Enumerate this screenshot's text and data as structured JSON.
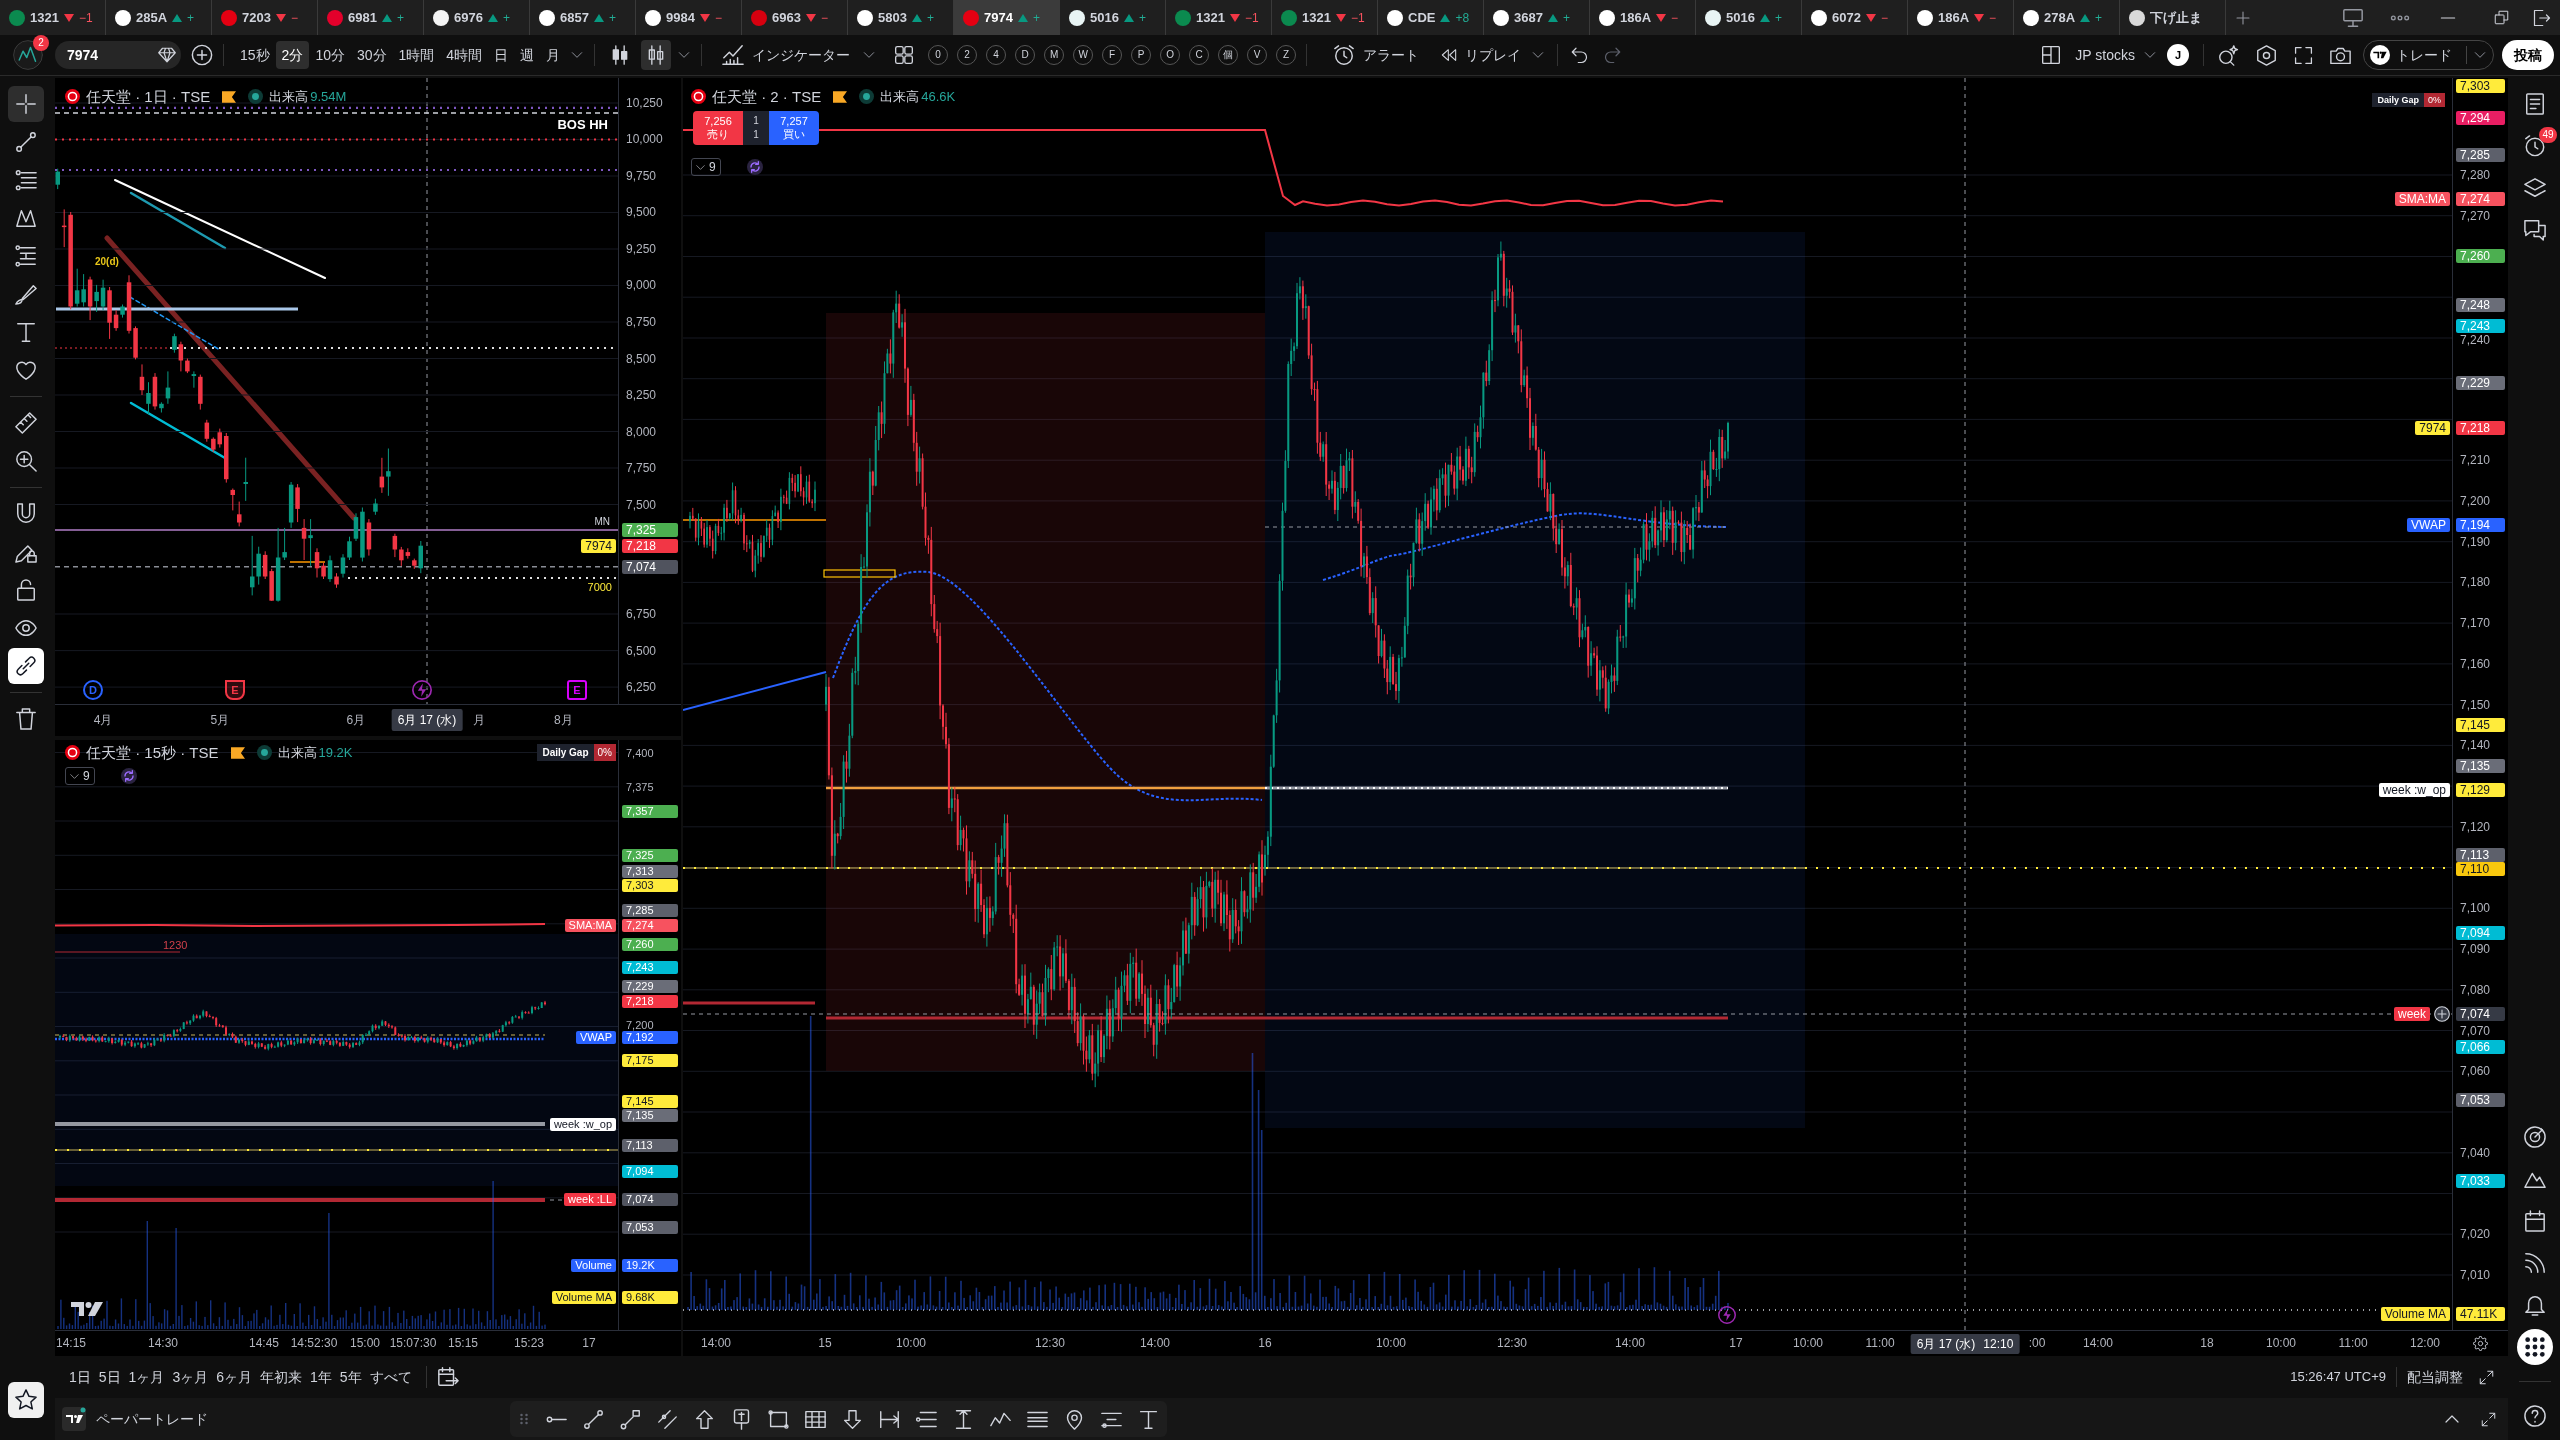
{
  "tabs": [
    {
      "symbol": "1321",
      "change": "−1",
      "rising": false,
      "color": "#0b8a4f",
      "selected": false
    },
    {
      "symbol": "285A",
      "change": "+",
      "rising": true,
      "color": "#ffffff",
      "selected": false
    },
    {
      "symbol": "7203",
      "change": "−",
      "rising": false,
      "color": "#e50012",
      "selected": false
    },
    {
      "symbol": "6981",
      "change": "+",
      "rising": true,
      "color": "#e4002b",
      "selected": false
    },
    {
      "symbol": "6976",
      "change": "+",
      "rising": true,
      "color": "#f4f4f4",
      "selected": false
    },
    {
      "symbol": "6857",
      "change": "+",
      "rising": true,
      "color": "#ffffff",
      "selected": false
    },
    {
      "symbol": "9984",
      "change": "−",
      "rising": false,
      "color": "#ffffff",
      "selected": false
    },
    {
      "symbol": "6963",
      "change": "−",
      "rising": false,
      "color": "#d7000f",
      "selected": false
    },
    {
      "symbol": "5803",
      "change": "+",
      "rising": true,
      "color": "#ffffff",
      "selected": false
    },
    {
      "symbol": "7974",
      "change": "+",
      "rising": true,
      "color": "#e60012",
      "selected": true
    },
    {
      "symbol": "5016",
      "change": "+",
      "rising": true,
      "color": "#e8f4f4",
      "selected": false
    },
    {
      "symbol": "1321",
      "change": "−1",
      "rising": false,
      "color": "#0b8a4f",
      "selected": false
    },
    {
      "symbol": "1321",
      "change": "−1",
      "rising": false,
      "color": "#0b8a4f",
      "selected": false
    },
    {
      "symbol": "CDE",
      "change": "+8",
      "rising": true,
      "color": "#ffffff",
      "selected": false
    },
    {
      "symbol": "3687",
      "change": "+",
      "rising": true,
      "color": "#ffffff",
      "selected": false
    },
    {
      "symbol": "186A",
      "change": "−",
      "rising": false,
      "color": "#ffffff",
      "selected": false
    },
    {
      "symbol": "5016",
      "change": "+",
      "rising": true,
      "color": "#e8f4f4",
      "selected": false
    },
    {
      "symbol": "6072",
      "change": "−",
      "rising": false,
      "color": "#ffffff",
      "selected": false
    },
    {
      "symbol": "186A",
      "change": "−",
      "rising": false,
      "color": "#ffffff",
      "selected": false
    },
    {
      "symbol": "278A",
      "change": "+",
      "rising": true,
      "color": "#ffffff",
      "selected": false
    },
    {
      "symbol": "下げ止ま",
      "color": "#d9d9d9",
      "selected": false
    }
  ],
  "toolbar": {
    "avatar_badge": "2",
    "symbol": "7974",
    "intervals": [
      {
        "label": "15秒",
        "selected": false
      },
      {
        "label": "2分",
        "selected": true
      },
      {
        "label": "10分",
        "selected": false
      },
      {
        "label": "30分",
        "selected": false
      },
      {
        "label": "1時間",
        "selected": false
      },
      {
        "label": "4時間",
        "selected": false
      },
      {
        "label": "日",
        "selected": false
      },
      {
        "label": "週",
        "selected": false
      },
      {
        "label": "月",
        "selected": false
      }
    ],
    "chart_styles": [
      {
        "kind": "candles",
        "selected": false
      },
      {
        "kind": "hollow_candles",
        "selected": true
      }
    ],
    "indicators": "インジケーター",
    "quick_buttons": [
      "0",
      "2",
      "4",
      "D",
      "M",
      "W",
      "F",
      "P",
      "O",
      "C",
      "個",
      "V",
      "Z"
    ],
    "alert": "アラート",
    "replay": "リプレイ",
    "watchlist": "JP stocks",
    "user_initial": "J",
    "trade": "トレード",
    "publish": "投稿"
  },
  "left_toolbar": [
    {
      "kind": "crosshair",
      "active": true
    },
    {
      "kind": "trend_line",
      "active": false
    },
    {
      "kind": "fib",
      "active": false
    },
    {
      "kind": "pattern",
      "active": false
    },
    {
      "kind": "projection",
      "active": false
    },
    {
      "kind": "brush",
      "active": false
    },
    {
      "kind": "text",
      "active": false
    },
    {
      "kind": "favorite",
      "active": false
    },
    {
      "kind": "ruler",
      "active": false
    },
    {
      "kind": "zoom",
      "active": false
    },
    {
      "kind": "magnet",
      "active": false
    },
    {
      "kind": "lock_drawing",
      "active": false
    },
    {
      "kind": "lock",
      "active": false
    },
    {
      "kind": "visibility",
      "active": false
    },
    {
      "kind": "link",
      "active": true
    },
    {
      "kind": "trash",
      "active": false
    }
  ],
  "daily_chart": {
    "title": "任天堂 · 1日 · TSE",
    "volume_label": "出来高",
    "volume": "9.54M",
    "structure_label": "BOS HH",
    "line_label": "20(d)",
    "level_label": "7000",
    "tag_note": "MN",
    "chart_data": {
      "type": "candlestick",
      "grid": true,
      "ylim": [
        6134,
        10421
      ],
      "yticks": [
        {
          "value": 10250,
          "label": "10,250"
        },
        {
          "value": 10000,
          "label": "10,000"
        },
        {
          "value": 9750,
          "label": "9,750"
        },
        {
          "value": 9500,
          "label": "9,500"
        },
        {
          "value": 9250,
          "label": "9,250"
        },
        {
          "value": 9000,
          "label": "9,000"
        },
        {
          "value": 8750,
          "label": "8,750"
        },
        {
          "value": 8500,
          "label": "8,500"
        },
        {
          "value": 8250,
          "label": "8,250"
        },
        {
          "value": 8000,
          "label": "8,000"
        },
        {
          "value": 7750,
          "label": "7,750"
        },
        {
          "value": 7500,
          "label": "7,500"
        },
        {
          "value": 6750,
          "label": "6,750"
        },
        {
          "value": 6500,
          "label": "6,500"
        },
        {
          "value": 6250,
          "label": "6,250"
        }
      ],
      "categories": [
        null,
        null,
        null,
        null,
        null,
        null,
        null,
        "4月",
        null,
        null,
        null,
        null,
        null,
        null,
        null,
        null,
        null,
        null,
        null,
        null,
        null,
        null,
        null,
        null,
        null,
        "5月",
        null,
        null,
        null,
        null,
        null,
        null,
        null,
        null,
        null,
        null,
        null,
        null,
        null,
        null,
        null,
        null,
        null,
        null,
        null,
        null,
        "6月",
        null,
        null,
        null,
        null,
        null,
        null,
        null,
        null,
        null,
        null,
        null,
        null,
        null,
        null,
        null,
        null,
        null,
        null,
        "月",
        null,
        null,
        null,
        null,
        null,
        null,
        null,
        null,
        null,
        null,
        null,
        null,
        "8月",
        null,
        null,
        null,
        null,
        null,
        null,
        null,
        null
      ],
      "ohlc": [
        [
          9690,
          9800,
          9660,
          9780
        ],
        [
          9410,
          9521,
          9263,
          9400
        ],
        [
          9484,
          9503,
          8837,
          8856
        ],
        [
          8875,
          9115,
          8856,
          8967
        ],
        [
          8885,
          9078,
          8856,
          8974
        ],
        [
          9041,
          9060,
          8763,
          8856
        ],
        [
          8893,
          9004,
          8819,
          8956
        ],
        [
          8856,
          9040,
          8830,
          8985
        ],
        [
          8967,
          8990,
          8634,
          8745
        ],
        [
          8800,
          8830,
          8690,
          8708
        ],
        [
          8800,
          8870,
          8780,
          8856
        ],
        [
          9022,
          9070,
          8671,
          8690
        ],
        [
          8708,
          8720,
          8494,
          8505
        ],
        [
          8375,
          8460,
          8250,
          8283
        ],
        [
          8190,
          8338,
          8118,
          8264
        ],
        [
          8375,
          8400,
          8150,
          8172
        ],
        [
          8160,
          8200,
          8130,
          8190
        ],
        [
          8227,
          8412,
          8190,
          8301
        ],
        [
          8560,
          8670,
          8540,
          8653
        ],
        [
          8597,
          8615,
          8412,
          8486
        ],
        [
          8486,
          8500,
          8400,
          8412
        ],
        [
          8380,
          8412,
          8300,
          8393
        ],
        [
          8375,
          8390,
          8150,
          8190
        ],
        [
          8061,
          8080,
          7930,
          7950
        ],
        [
          7950,
          7960,
          7860,
          7876
        ],
        [
          7995,
          8020,
          7890,
          7913
        ],
        [
          7969,
          7990,
          7650,
          7673
        ],
        [
          7600,
          7610,
          7460,
          7565
        ],
        [
          7433,
          7520,
          7350,
          7377
        ],
        [
          7640,
          7821,
          7525,
          7654
        ],
        [
          6933,
          7285,
          6878,
          7007
        ],
        [
          7007,
          7211,
          6952,
          7163
        ],
        [
          7155,
          7180,
          6990,
          7007
        ],
        [
          7044,
          7060,
          6840,
          6841
        ],
        [
          6841,
          7340,
          6835,
          7137
        ],
        [
          7137,
          7340,
          7120,
          7174
        ],
        [
          7377,
          7654,
          7340,
          7636
        ],
        [
          7617,
          7640,
          7380,
          7470
        ],
        [
          7340,
          7400,
          7120,
          7266
        ],
        [
          7270,
          7400,
          7080,
          7290
        ],
        [
          7174,
          7200,
          7000,
          7063
        ],
        [
          7081,
          7100,
          6990,
          7007
        ],
        [
          6989,
          7150,
          6970,
          7118
        ],
        [
          7007,
          7030,
          6930,
          6952
        ],
        [
          7026,
          7160,
          7000,
          7137
        ],
        [
          7137,
          7280,
          7120,
          7248
        ],
        [
          7266,
          7440,
          7250,
          7414
        ],
        [
          7137,
          7480,
          7110,
          7451
        ],
        [
          7377,
          7400,
          7150,
          7193
        ],
        [
          7451,
          7540,
          7430,
          7507
        ],
        [
          7691,
          7820,
          7580,
          7617
        ],
        [
          7691,
          7884,
          7560,
          7728
        ],
        [
          7285,
          7300,
          7140,
          7192
        ],
        [
          7192,
          7210,
          7080,
          7118
        ],
        [
          7174,
          7200,
          7130,
          7148
        ],
        [
          7118,
          7130,
          7060,
          7081
        ],
        [
          7063,
          7250,
          7030,
          7218
        ],
        null,
        null,
        null,
        null,
        null,
        null,
        null,
        null,
        null,
        null,
        null,
        null,
        null,
        null,
        null,
        null,
        null,
        null,
        null,
        null,
        null,
        null,
        null,
        null,
        null,
        null,
        null,
        null,
        null,
        null
      ],
      "ref_lines": [
        {
          "axis": "y",
          "value": 10216,
          "color": "#7e57c2",
          "line_style": "dotted"
        },
        {
          "axis": "y",
          "value": 10181,
          "color": "#d1d4dc",
          "line_style": "dashed"
        },
        {
          "axis": "y",
          "value": 10000,
          "color": "#f23645",
          "line_style": "dotted"
        },
        {
          "axis": "y",
          "value": 9791,
          "color": "#7e57c2",
          "line_style": "dotted"
        },
        {
          "axis": "y",
          "value": 7325,
          "color": "#b07ec7",
          "line_style": "solid"
        },
        {
          "axis": "y",
          "value": 7074,
          "color": "#8a8d96",
          "line_style": "dashed"
        }
      ]
    },
    "price_tags": [
      {
        "text": "7,325",
        "color": "#4caf50"
      },
      {
        "text": "7,218",
        "color": "#f23645",
        "label": {
          "text": "7974",
          "color": "#ffeb3b"
        }
      },
      {
        "text": "7,074",
        "color": "#50535e"
      }
    ],
    "events": [
      {
        "kind": "dividend",
        "text": "D"
      },
      {
        "kind": "earnings",
        "text": "E"
      },
      {
        "kind": "flash"
      },
      {
        "kind": "future_earnings",
        "text": "E"
      }
    ],
    "crosshair_date": "6月 17 (水)"
  },
  "intraday_chart": {
    "title": "任天堂 · 15秒 · TSE",
    "volume_label": "出来高",
    "volume": "19.2K",
    "indicator_count": "9",
    "gap_label": "Daily Gap",
    "gap_value": "0%",
    "line_note": "1230",
    "price_labels": [
      "7,400",
      "7,375",
      "7,200"
    ],
    "price_tags": [
      {
        "text": "7,357",
        "color": "#4caf50"
      },
      {
        "text": "7,325",
        "color": "#4caf50"
      },
      {
        "text": "7,313",
        "color": "#6a6d78"
      },
      {
        "text": "7,303",
        "color": "#ffeb3b"
      },
      {
        "text": "7,285",
        "color": "#5d606b"
      },
      {
        "text": "7,274",
        "color": "#f7525f",
        "label": {
          "text": "SMA:MA",
          "color": "#f7525f"
        }
      },
      {
        "text": "7,260",
        "color": "#4caf50"
      },
      {
        "text": "7,243",
        "color": "#00bcd4"
      },
      {
        "text": "7,229",
        "color": "#6a6d78"
      },
      {
        "text": "7,218",
        "color": "#f23645"
      },
      {
        "text": "7,192",
        "color": "#2962ff",
        "label": {
          "text": "VWAP",
          "color": "#2962ff"
        }
      },
      {
        "text": "7,175",
        "color": "#ffeb3b"
      },
      {
        "text": "7,145",
        "color": "#ffeb3b"
      },
      {
        "text": "7,135",
        "color": "#6a6d78"
      },
      {
        "text": "7,113",
        "color": "#5d606b"
      },
      {
        "text": "7,094",
        "color": "#00bcd4"
      },
      {
        "text": "7,074",
        "color": "#50535e",
        "label": {
          "text": "week :LL",
          "color": "#f23645"
        }
      },
      {
        "text": "7,053",
        "color": "#5d606b"
      }
    ],
    "side_labels": [
      {
        "text": "week :w_op",
        "color": "#ffffff"
      }
    ],
    "volume_tags": [
      {
        "label": "Volume",
        "text": "19.2K",
        "color": "#2962ff"
      },
      {
        "label": "Volume MA",
        "text": "9.68K",
        "color": "#ffeb3b"
      }
    ],
    "time_labels": [
      "14:15",
      "14:30",
      "14:45",
      "14:52:30",
      "15:00",
      "15:07:30",
      "15:15",
      "15:23",
      "17"
    ]
  },
  "main_chart": {
    "title": "任天堂 · 2 · TSE",
    "volume_label": "出来高",
    "volume": "46.6K",
    "trade": {
      "sell_price": "7,256",
      "sell_label": "売り",
      "quantity": "1",
      "spread": "1",
      "buy_price": "7,257",
      "buy_label": "買い"
    },
    "indicator_count": "9",
    "gap_label": "Daily Gap",
    "gap_value": "0%",
    "price_labels": [
      "7,280",
      "7,270",
      "7,240",
      "7,210",
      "7,200",
      "7,190",
      "7,180",
      "7,170",
      "7,160",
      "7,150",
      "7,140",
      "7,120",
      "7,100",
      "7,090",
      "7,080",
      "7,070",
      "7,060",
      "7,040",
      "7,020",
      "7,010"
    ],
    "price_tags": [
      {
        "text": "7,303",
        "color": "#ffeb3b"
      },
      {
        "text": "7,294",
        "color": "#e91e63"
      },
      {
        "text": "7,285",
        "color": "#5d606b"
      },
      {
        "text": "7,274",
        "color": "#f7525f",
        "label": {
          "text": "SMA:MA",
          "color": "#f7525f"
        }
      },
      {
        "text": "7,260",
        "color": "#4caf50"
      },
      {
        "text": "7,248",
        "color": "#6a6d78"
      },
      {
        "text": "7,243",
        "color": "#00bcd4"
      },
      {
        "text": "7,229",
        "color": "#6a6d78"
      },
      {
        "text": "7,218",
        "color": "#f23645",
        "label": {
          "text": "7974",
          "color": "#ffeb3b"
        }
      },
      {
        "text": "7,194",
        "color": "#2962ff",
        "label": {
          "text": "VWAP",
          "color": "#2962ff"
        }
      },
      {
        "text": "7,145",
        "color": "#ffeb3b"
      },
      {
        "text": "7,135",
        "color": "#6a6d78"
      },
      {
        "text": "7,129",
        "color": "#ffeb3b",
        "label": {
          "text": "week :w_op",
          "color": "#ffffff"
        }
      },
      {
        "text": "7,113",
        "color": "#5d606b"
      },
      {
        "text": "7,110",
        "color": "#f9c80e"
      },
      {
        "text": "7,094",
        "color": "#00bcd4"
      },
      {
        "text": "7,066",
        "color": "#00bcd4"
      },
      {
        "text": "7,053",
        "color": "#5d606b"
      },
      {
        "text": "7,033",
        "color": "#00bcd4"
      }
    ],
    "crosshair_price": {
      "text": "7,074",
      "label": {
        "text": "week",
        "color": "#f23645"
      }
    },
    "volume_tags": [
      {
        "label": "Volume MA",
        "text": "47.11K",
        "color": "#ffeb3b"
      }
    ],
    "time_labels": [
      "14:00",
      "15",
      "10:00",
      "12:30",
      "14:00",
      "16",
      "10:00",
      "12:30",
      "14:00",
      "17",
      "10:00",
      "11:00",
      ":00",
      "14:00",
      "18",
      "10:00",
      "11:00",
      "12:00"
    ],
    "crosshair_date": "6月 17 (水)",
    "crosshair_time": "12:10"
  },
  "range_bar": {
    "ranges": [
      "1日",
      "5日",
      "1ヶ月",
      "3ヶ月",
      "6ヶ月",
      "年初来",
      "1年",
      "5年",
      "すべて"
    ],
    "clock": "15:26:47 UTC+9",
    "adjustment": "配当調整"
  },
  "bottom_bar": {
    "panel_tab": "ペーパートレード"
  },
  "right_sidebar": [
    {
      "kind": "watchlist",
      "active": false
    },
    {
      "kind": "alerts",
      "active": false,
      "badge": "49"
    },
    {
      "kind": "object_tree",
      "active": false
    },
    {
      "kind": "chats",
      "active": false
    },
    {
      "kind": "ideas",
      "active": false
    },
    {
      "kind": "pine",
      "active": false
    },
    {
      "kind": "calendar",
      "active": false
    },
    {
      "kind": "news",
      "active": false
    },
    {
      "kind": "notifications",
      "active": false
    },
    {
      "kind": "products",
      "active": true
    },
    {
      "kind": "help",
      "active": false
    }
  ]
}
